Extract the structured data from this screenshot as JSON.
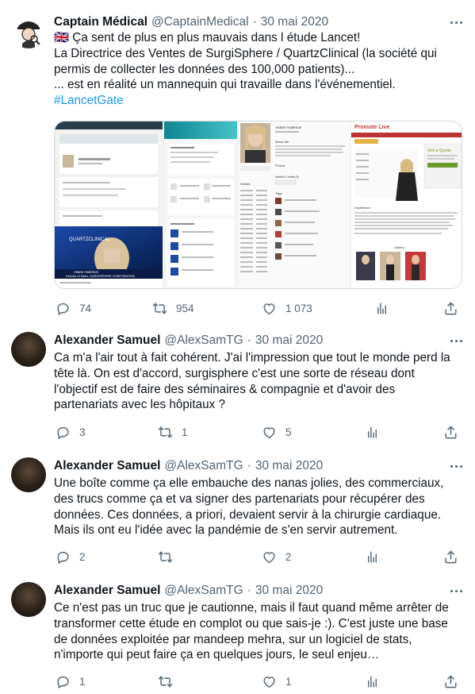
{
  "tweets": [
    {
      "name": "Captain Médical",
      "handle": "@CaptainMedical",
      "date": "30 mai 2020",
      "lines": [
        "🇬🇧 Ça sent de plus en plus mauvais dans l étude Lancet!",
        "La Directrice des Ventes de SurgiSphere / QuartzClinical (la société  qui",
        "permis de collecter les données des 100,000 patients)...",
        "... est en réalité un mannequin qui travaille dans l'événementiel."
      ],
      "hashtag": "#LancetGate",
      "media": {
        "caption_name": "Ariane Anderson",
        "caption_title": "Director of Sales, SURGISPHERE CORPORATION",
        "brand": "QUARTZCLINICAL",
        "site_title": "Promote Live",
        "quote_label": "Get a Quote",
        "profile_name": "Ariane Anderson",
        "about_label": "About Me",
        "photos_label": "Photos",
        "tags_label": "Tags",
        "details_label": "Details",
        "verified_label": "Verified Credits (0)",
        "experience_label": "Experience",
        "gallery_label": "Gallery"
      },
      "counts": {
        "reply": "74",
        "retweet": "954",
        "like": "1 073"
      }
    },
    {
      "name": "Alexander Samuel",
      "handle": "@AlexSamTG",
      "date": "30 mai 2020",
      "lines": [
        "Ca m'a l'air tout à fait cohérent. J'ai l'impression que tout le monde perd la",
        "tête là. On est d'accord, surgisphere c'est une sorte de réseau dont",
        "l'objectif est de faire des séminaires & compagnie et d'avoir des",
        "partenariats avec les hôpitaux ?"
      ],
      "counts": {
        "reply": "3",
        "retweet": "1",
        "like": "5"
      }
    },
    {
      "name": "Alexander Samuel",
      "handle": "@AlexSamTG",
      "date": "30 mai 2020",
      "lines": [
        "Une boîte comme ça elle embauche des nanas jolies, des commerciaux,",
        "des trucs comme ça et va signer des partenariats pour récupérer des",
        "données. Ces données, a priori, devaient servir à la chirurgie cardiaque.",
        "Mais ils ont eu l'idée avec la pandémie de s'en servir autrement."
      ],
      "counts": {
        "reply": "2",
        "retweet": "",
        "like": "2"
      }
    },
    {
      "name": "Alexander Samuel",
      "handle": "@AlexSamTG",
      "date": "30 mai 2020",
      "lines": [
        "Ce n'est pas un truc que je cautionne, mais il faut quand même arrêter de",
        "transformer cette étude en complot ou que sais-je :). C'est juste une base",
        "de données exploitée par mandeep mehra, sur un logiciel de stats,",
        "n'importe qui peut faire ça en quelques jours, le seul enjeu…"
      ],
      "counts": {
        "reply": "1",
        "retweet": "",
        "like": "1"
      }
    }
  ],
  "icons": [
    "reply-icon",
    "retweet-icon",
    "like-icon",
    "analytics-icon",
    "share-icon",
    "more-icon"
  ],
  "colors": {
    "text": "#0f1419",
    "secondary": "#536471",
    "link": "#1d9bf0",
    "border": "#cfd9de"
  }
}
